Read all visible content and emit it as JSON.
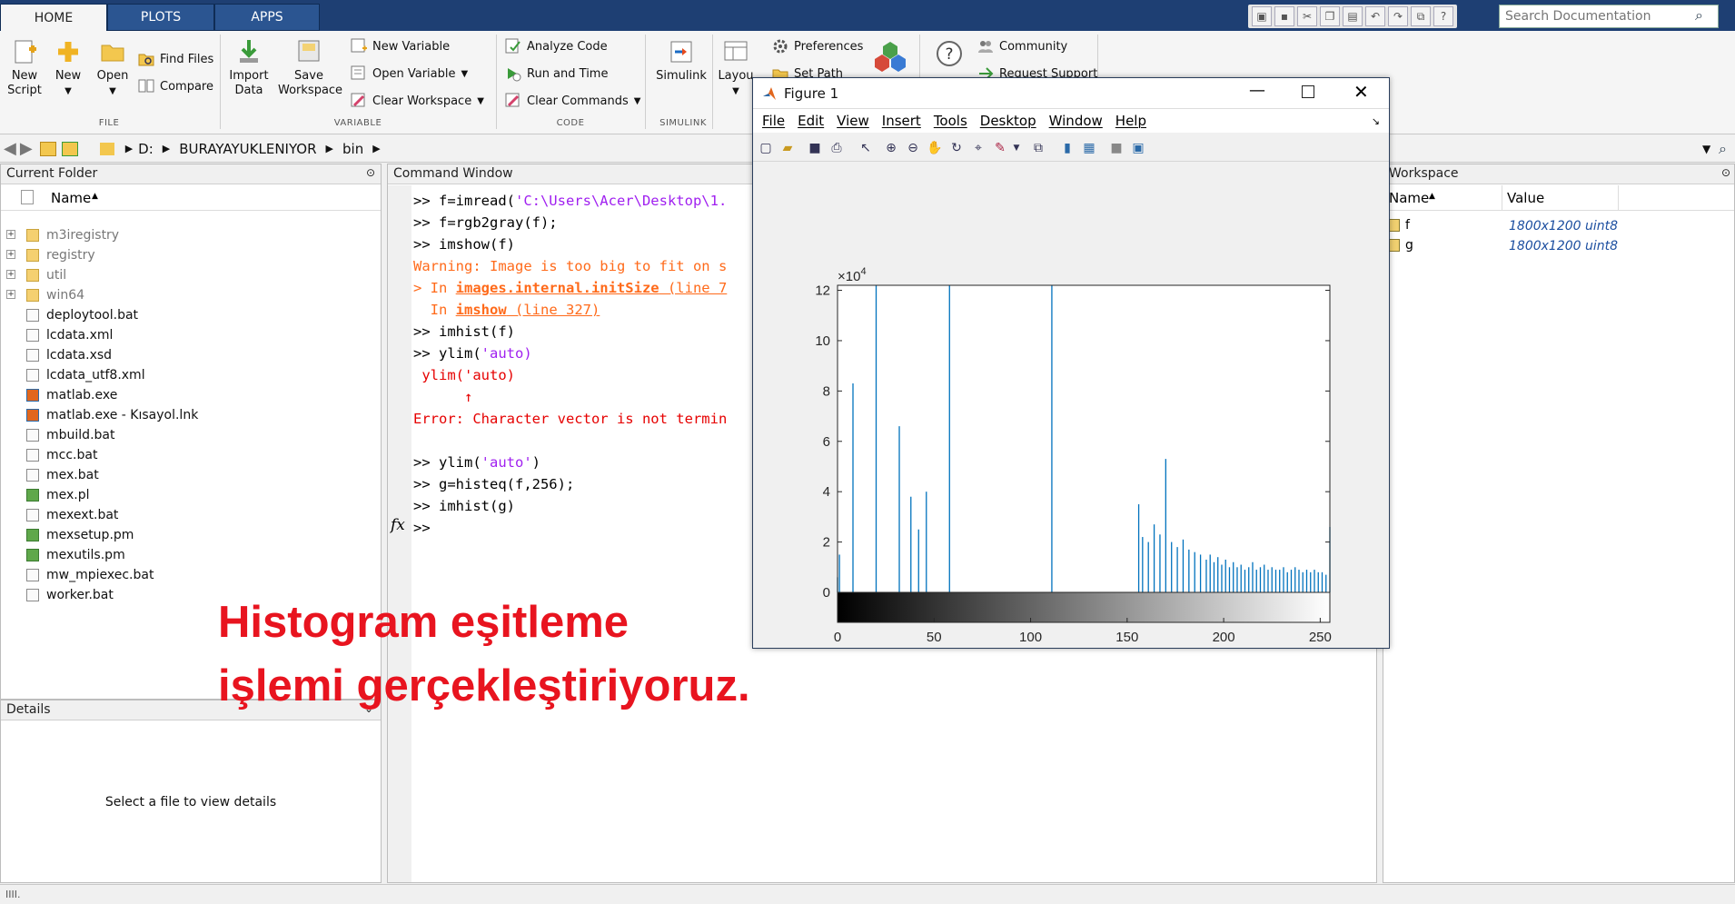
{
  "tabs": [
    {
      "label": "HOME"
    },
    {
      "label": "PLOTS"
    },
    {
      "label": "APPS"
    }
  ],
  "search": {
    "placeholder": "Search Documentation"
  },
  "ribbon": {
    "file": {
      "new_script": "New\nScript",
      "new": "New",
      "open": "Open",
      "find_files": "Find Files",
      "compare": "Compare",
      "group": "FILE"
    },
    "variable": {
      "import": "Import\nData",
      "save_ws": "Save\nWorkspace",
      "new_var": "New Variable",
      "open_var": "Open Variable",
      "clear_ws": "Clear Workspace",
      "group": "VARIABLE"
    },
    "code": {
      "analyze": "Analyze Code",
      "run_time": "Run and Time",
      "clear_cmds": "Clear Commands",
      "group": "CODE"
    },
    "simulink": {
      "label": "Simulink",
      "group": "SIMULINK"
    },
    "environment": {
      "layout": "Layou",
      "preferences": "Preferences",
      "set_path": "Set Path"
    },
    "resources": {
      "community": "Community",
      "request_support": "Request Support"
    }
  },
  "address": {
    "drive": "D:",
    "folder1": "BURAYAYUKLENIYOR",
    "folder2": "bin"
  },
  "current_folder": {
    "title": "Current Folder",
    "name_col": "Name",
    "items": [
      {
        "name": "m3iregistry",
        "kind": "folder"
      },
      {
        "name": "registry",
        "kind": "folder"
      },
      {
        "name": "util",
        "kind": "folder"
      },
      {
        "name": "win64",
        "kind": "folder"
      },
      {
        "name": "deploytool.bat",
        "kind": "file"
      },
      {
        "name": "lcdata.xml",
        "kind": "file"
      },
      {
        "name": "lcdata.xsd",
        "kind": "file"
      },
      {
        "name": "lcdata_utf8.xml",
        "kind": "file"
      },
      {
        "name": "matlab.exe",
        "kind": "exe"
      },
      {
        "name": "matlab.exe - Kısayol.lnk",
        "kind": "exe"
      },
      {
        "name": "mbuild.bat",
        "kind": "file"
      },
      {
        "name": "mcc.bat",
        "kind": "file"
      },
      {
        "name": "mex.bat",
        "kind": "file"
      },
      {
        "name": "mex.pl",
        "kind": "script"
      },
      {
        "name": "mexext.bat",
        "kind": "file"
      },
      {
        "name": "mexsetup.pm",
        "kind": "script"
      },
      {
        "name": "mexutils.pm",
        "kind": "script"
      },
      {
        "name": "mw_mpiexec.bat",
        "kind": "file"
      },
      {
        "name": "worker.bat",
        "kind": "file"
      }
    ]
  },
  "details": {
    "title": "Details",
    "placeholder": "Select a file to view details"
  },
  "command_window": {
    "title": "Command Window",
    "l1a": ">> f=imread(",
    "l1b": "'C:\\Users\\Acer\\Desktop\\1.",
    "l2": ">> f=rgb2gray(f);",
    "l3": ">> imshow(f)",
    "l4": "Warning: Image is too big to fit on s",
    "l5a": "> In ",
    "l5b": "images.internal.initSize",
    "l5c": " (line 7",
    "l6a": "  In ",
    "l6b": "imshow",
    "l6c": " (line 327)",
    "l7": ">> imhist(f)",
    "l8a": ">> ylim(",
    "l8b": "'auto)",
    "l9": " ylim('auto)",
    "l10": "      ↑",
    "l11": "Error: Character vector is not termin",
    "l12a": ">> ylim(",
    "l12b": "'auto'",
    "l12c": ")",
    "l13": ">> g=histeq(f,256);",
    "l14": ">> imhist(g)",
    "fx": "fx",
    "prompt": ">>"
  },
  "workspace": {
    "title": "Workspace",
    "col_name": "Name",
    "col_value": "Value",
    "vars": [
      {
        "name": "f",
        "value": "1800x1200 uint8"
      },
      {
        "name": "g",
        "value": "1800x1200 uint8"
      }
    ]
  },
  "figure": {
    "title": "Figure 1",
    "menu": [
      "File",
      "Edit",
      "View",
      "Insert",
      "Tools",
      "Desktop",
      "Window",
      "Help"
    ]
  },
  "overlay": {
    "line1": "Histogram eşitleme",
    "line2": "işlemi gerçekleştiriyoruz."
  },
  "chart_data": {
    "type": "bar",
    "title": "",
    "xlabel": "",
    "ylabel": "",
    "y_exponent_label": "×10",
    "y_exponent": "4",
    "xlim": [
      0,
      255
    ],
    "ylim": [
      0,
      12.2
    ],
    "xticks": [
      0,
      50,
      100,
      150,
      200,
      250
    ],
    "yticks": [
      0,
      2,
      4,
      6,
      8,
      10,
      12
    ],
    "units_note": "y values in units of 10^4",
    "x": [
      0,
      1,
      8,
      20,
      32,
      38,
      42,
      46,
      58,
      111,
      156,
      158,
      161,
      164,
      167,
      170,
      173,
      176,
      179,
      182,
      185,
      188,
      191,
      193,
      195,
      197,
      199,
      201,
      203,
      205,
      207,
      209,
      211,
      213,
      215,
      217,
      219,
      221,
      223,
      225,
      227,
      229,
      231,
      233,
      235,
      237,
      239,
      241,
      243,
      245,
      247,
      249,
      251,
      253,
      255
    ],
    "values": [
      0.6,
      1.5,
      8.3,
      12.2,
      6.6,
      3.8,
      2.5,
      4.0,
      12.2,
      12.2,
      3.5,
      2.2,
      2.0,
      2.7,
      2.3,
      5.3,
      2.0,
      1.8,
      2.1,
      1.7,
      1.6,
      1.5,
      1.3,
      1.5,
      1.2,
      1.4,
      1.1,
      1.3,
      1.0,
      1.2,
      1.0,
      1.1,
      0.9,
      1.0,
      1.2,
      0.9,
      1.0,
      1.1,
      0.9,
      1.0,
      0.9,
      0.9,
      1.0,
      0.8,
      0.9,
      1.0,
      0.9,
      0.8,
      0.9,
      0.8,
      0.9,
      0.8,
      0.8,
      0.7,
      2.6
    ]
  }
}
